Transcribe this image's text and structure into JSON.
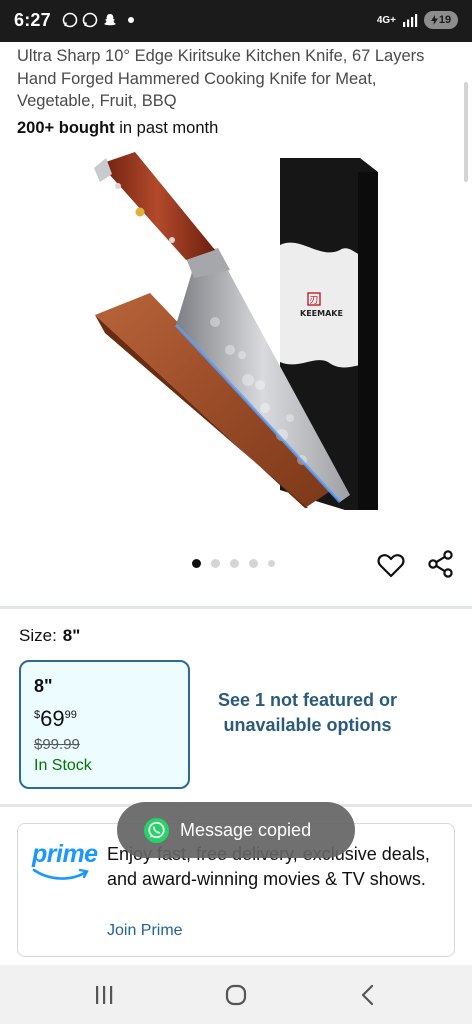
{
  "status_bar": {
    "time": "6:27",
    "network": "4G+",
    "battery": "19"
  },
  "product": {
    "title": "Ultra Sharp 10° Edge Kiritsuke Kitchen Knife, 67 Layers Hand Forged Hammered Cooking Knife for Meat, Vegetable, Fruit, BBQ",
    "bought_bold": "200+ bought",
    "bought_rest": " in past month",
    "image_brand": "KEEMAKE",
    "image_logo_char": "刃"
  },
  "carousel": {
    "count": 5,
    "active_index": 0
  },
  "size": {
    "label": "Size:",
    "selected": "8\"",
    "option": {
      "name": "8\"",
      "currency": "$",
      "price_whole": "69",
      "price_fraction": "99",
      "list_price": "$99.99",
      "availability": "In Stock"
    },
    "see_more": "See 1 not featured or unavailable options"
  },
  "prime": {
    "logo": "prime",
    "text": "Enjoy fast, free delivery, exclusive deals, and award-winning movies & TV shows.",
    "link": "Join Prime"
  },
  "toast": {
    "text": "Message copied"
  },
  "icons": {
    "heart": "heart-icon",
    "share": "share-icon",
    "whatsapp": "whatsapp-icon",
    "nav_recents": "recents-icon",
    "nav_home": "home-icon",
    "nav_back": "back-icon"
  },
  "colors": {
    "accent_blue": "#2a6a93",
    "prime_blue": "#1a98ff",
    "in_stock": "#007600",
    "link": "#2162a1"
  }
}
